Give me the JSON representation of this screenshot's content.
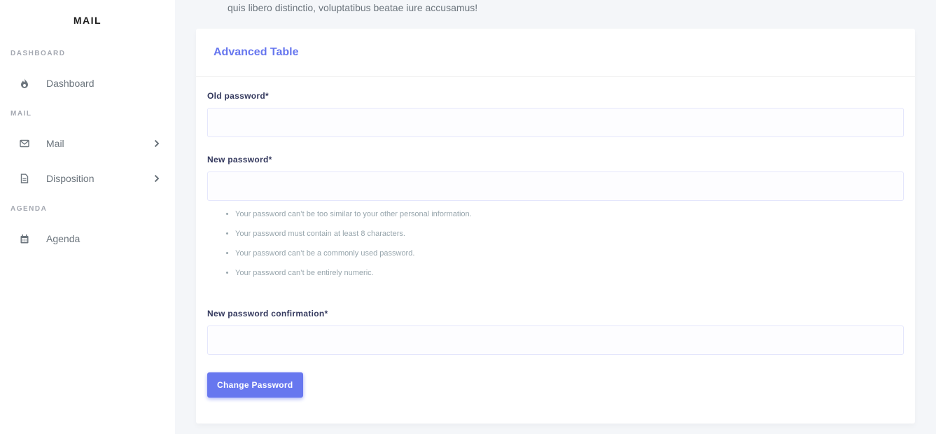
{
  "sidebar": {
    "brand": "MAIL",
    "sections": [
      {
        "header": "DASHBOARD",
        "items": [
          {
            "label": "Dashboard",
            "icon": "fire-icon",
            "has_submenu": false
          }
        ]
      },
      {
        "header": "MAIL",
        "items": [
          {
            "label": "Mail",
            "icon": "envelope-icon",
            "has_submenu": true
          },
          {
            "label": "Disposition",
            "icon": "file-icon",
            "has_submenu": true
          }
        ]
      },
      {
        "header": "AGENDA",
        "items": [
          {
            "label": "Agenda",
            "icon": "calendar-icon",
            "has_submenu": false
          }
        ]
      }
    ]
  },
  "main": {
    "intro_text": "quis libero distinctio, voluptatibus beatae iure accusamus!",
    "card": {
      "title": "Advanced Table",
      "fields": [
        {
          "label": "Old password*",
          "value": "",
          "placeholder": ""
        },
        {
          "label": "New password*",
          "value": "",
          "placeholder": ""
        },
        {
          "label": "New password confirmation*",
          "value": "",
          "placeholder": ""
        }
      ],
      "help_text": [
        "Your password can’t be too similar to your other personal information.",
        "Your password must contain at least 8 characters.",
        "Your password can’t be a commonly used password.",
        "Your password can’t be entirely numeric."
      ],
      "submit_label": "Change Password"
    }
  },
  "colors": {
    "accent": "#6777ef",
    "background": "#f4f6f9",
    "muted_text": "#98a6ad"
  }
}
